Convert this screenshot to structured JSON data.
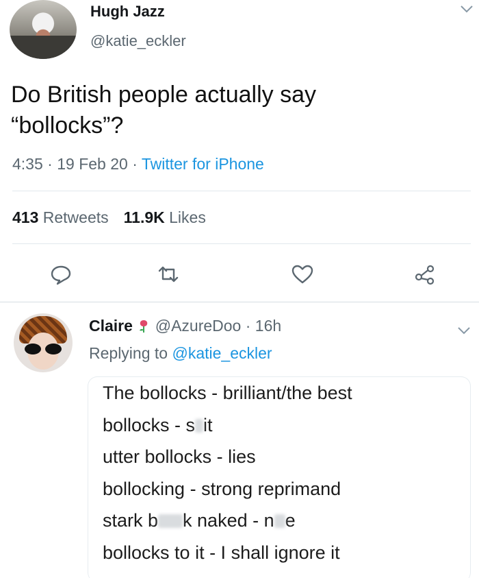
{
  "tweet": {
    "author_name": "Hugh Jazz",
    "author_handle": "@katie_eckler",
    "text_line1": "Do British people actually say",
    "text_line2": "“bollocks”?",
    "time": "4:35",
    "date": "19 Feb 20",
    "source": "Twitter for iPhone",
    "dot": "·",
    "retweets_count": "413",
    "retweets_label": "Retweets",
    "likes_count": "11.9K",
    "likes_label": "Likes",
    "actions": [
      "reply-icon",
      "retweet-icon",
      "like-icon",
      "share-icon"
    ]
  },
  "reply": {
    "author_name": "Claire",
    "author_handle": "@AzureDoo",
    "age": "16h",
    "replying_prefix": "Replying to",
    "replying_to": "@katie_eckler",
    "lines": {
      "l1": "The bollocks - brilliant/the best",
      "l2a": "bollocks - s",
      "l2b": "it",
      "l3": "utter bollocks - lies",
      "l4": "bollocking - strong reprimand",
      "l5a": "stark b",
      "l5b": "k naked - n",
      "l5c": "e",
      "l6": "bollocks to it - I shall ignore it"
    }
  },
  "colors": {
    "link": "#1b95e0",
    "muted": "#5b6770",
    "divider": "#e1e8ed"
  }
}
